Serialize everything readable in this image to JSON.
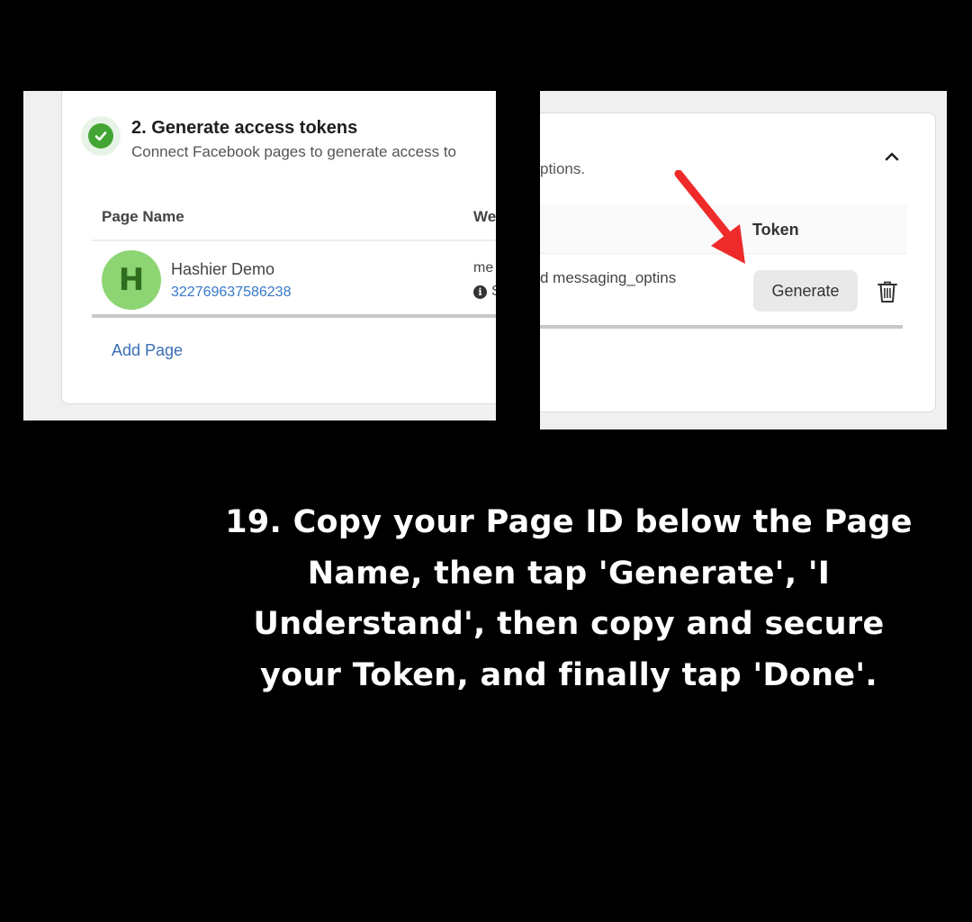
{
  "left_panel": {
    "step_title": "2. Generate access tokens",
    "step_subtitle": "Connect Facebook pages to generate access to",
    "columns": [
      "Page Name",
      "We"
    ],
    "row": {
      "avatar_letter": "H",
      "page_name": "Hashier Demo",
      "page_id": "322769637586238",
      "truncated_col_text": "me",
      "truncated_col_text2": "S"
    },
    "add_page_label": "Add Page",
    "check_icon": "check-circle-icon",
    "accent_color": "#42a533"
  },
  "right_panel": {
    "options_fragment": "ptions.",
    "token_header": "Token",
    "permissions_fragment": "d messaging_optins",
    "generate_label": "Generate",
    "arrow_color": "#ee2a2a"
  },
  "caption": "19. Copy your Page ID below the Page Name, then tap 'Generate', 'I Understand', then copy and secure your Token, and finally tap 'Done'."
}
